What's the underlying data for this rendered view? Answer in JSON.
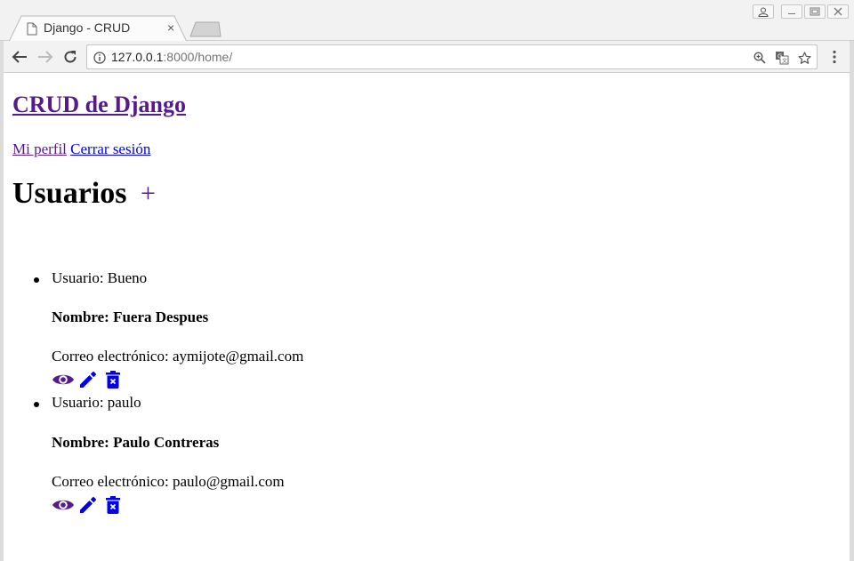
{
  "browser": {
    "tab_title": "Django - CRUD",
    "tab_close": "×",
    "url_host": "127.0.0.1",
    "url_rest": ":8000/home/"
  },
  "page": {
    "site_title": "CRUD de Django",
    "nav": {
      "profile": "Mi perfil",
      "logout": "Cerrar sesión"
    },
    "heading": "Usuarios",
    "add_symbol": "+",
    "users": [
      {
        "usuario": "Usuario: Bueno",
        "nombre": "Nombre: Fuera Despues",
        "correo": "Correo electrónico: aymijote@gmail.com"
      },
      {
        "usuario": "Usuario: paulo",
        "nombre": "Nombre: Paulo Contreras",
        "correo": "Correo electrónico: paulo@gmail.com"
      }
    ],
    "action_icons": [
      "eye-icon",
      "pencil-icon",
      "trash-icon"
    ]
  },
  "colors": {
    "visited_link": "#551a8b",
    "link": "#0000ee",
    "eye_icon": "#551a8b",
    "edit_icon": "#0000ee"
  }
}
